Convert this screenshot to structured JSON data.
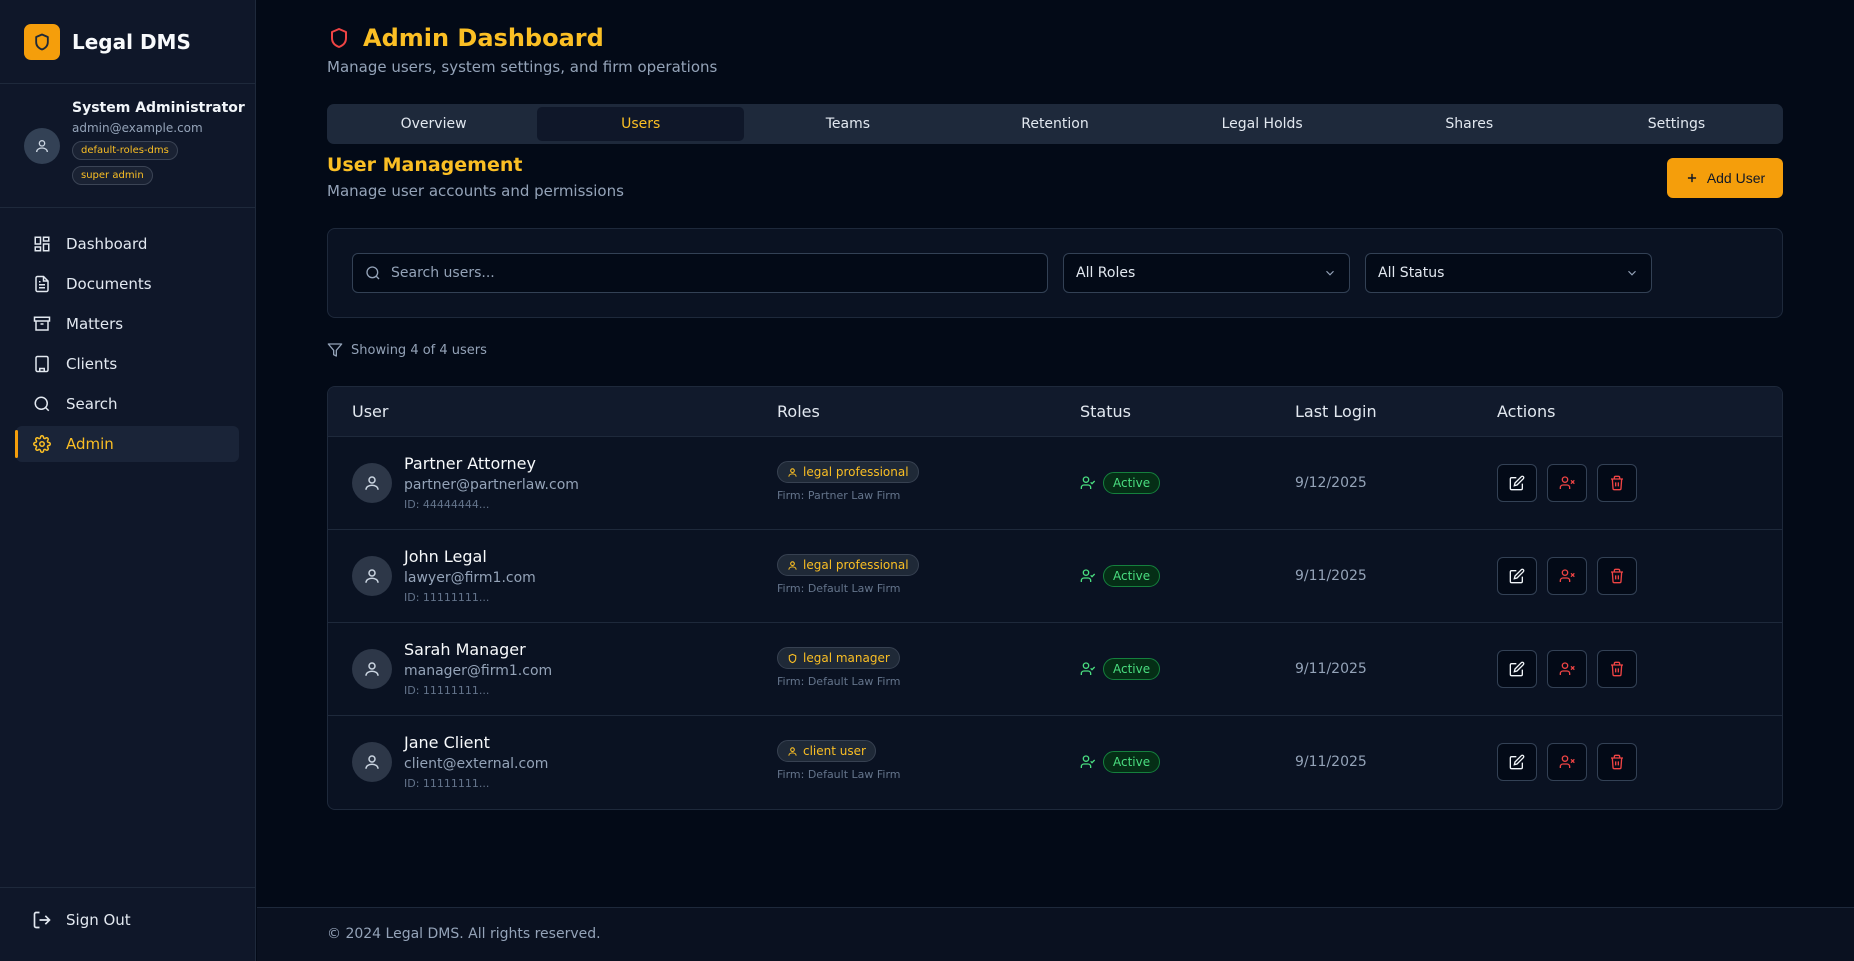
{
  "app": {
    "name": "Legal DMS"
  },
  "profile": {
    "name": "System Administrator",
    "email": "admin@example.com",
    "roles": [
      "default-roles-dms",
      "super admin"
    ]
  },
  "nav": {
    "items": [
      {
        "label": "Dashboard",
        "icon": "dashboard-icon",
        "active": false
      },
      {
        "label": "Documents",
        "icon": "document-icon",
        "active": false
      },
      {
        "label": "Matters",
        "icon": "archive-icon",
        "active": false
      },
      {
        "label": "Clients",
        "icon": "building-icon",
        "active": false
      },
      {
        "label": "Search",
        "icon": "search-icon",
        "active": false
      },
      {
        "label": "Admin",
        "icon": "gear-icon",
        "active": true
      }
    ],
    "sign_out": "Sign Out"
  },
  "header": {
    "title": "Admin Dashboard",
    "subtitle": "Manage users, system settings, and firm operations"
  },
  "tabs": [
    {
      "label": "Overview",
      "active": false
    },
    {
      "label": "Users",
      "active": true
    },
    {
      "label": "Teams",
      "active": false
    },
    {
      "label": "Retention",
      "active": false
    },
    {
      "label": "Legal Holds",
      "active": false
    },
    {
      "label": "Shares",
      "active": false
    },
    {
      "label": "Settings",
      "active": false
    }
  ],
  "section": {
    "title": "User Management",
    "subtitle": "Manage user accounts and permissions",
    "add_label": "Add User"
  },
  "filters": {
    "search_placeholder": "Search users...",
    "role_value": "All Roles",
    "status_value": "All Status"
  },
  "showing_text": "Showing 4 of 4 users",
  "table": {
    "headers": {
      "user": "User",
      "roles": "Roles",
      "status": "Status",
      "last_login": "Last Login",
      "actions": "Actions"
    },
    "rows": [
      {
        "name": "Partner Attorney",
        "email": "partner@partnerlaw.com",
        "id": "ID: 44444444...",
        "role": "legal professional",
        "role_icon": "user-icon",
        "firm": "Firm: Partner Law Firm",
        "status": "Active",
        "last_login": "9/12/2025"
      },
      {
        "name": "John Legal",
        "email": "lawyer@firm1.com",
        "id": "ID: 11111111...",
        "role": "legal professional",
        "role_icon": "user-icon",
        "firm": "Firm: Default Law Firm",
        "status": "Active",
        "last_login": "9/11/2025"
      },
      {
        "name": "Sarah Manager",
        "email": "manager@firm1.com",
        "id": "ID: 11111111...",
        "role": "legal manager",
        "role_icon": "shield-icon",
        "firm": "Firm: Default Law Firm",
        "status": "Active",
        "last_login": "9/11/2025"
      },
      {
        "name": "Jane Client",
        "email": "client@external.com",
        "id": "ID: 11111111...",
        "role": "client user",
        "role_icon": "user-icon",
        "firm": "Firm: Default Law Firm",
        "status": "Active",
        "last_login": "9/11/2025"
      }
    ]
  },
  "footer": {
    "text": "© 2024 Legal DMS. All rights reserved."
  },
  "colors": {
    "accent": "#f59e0b",
    "accent_text": "#fbbf24",
    "background": "#030a17",
    "sidebar": "#0f1729",
    "success": "#4ade80",
    "danger": "#ef4444"
  }
}
